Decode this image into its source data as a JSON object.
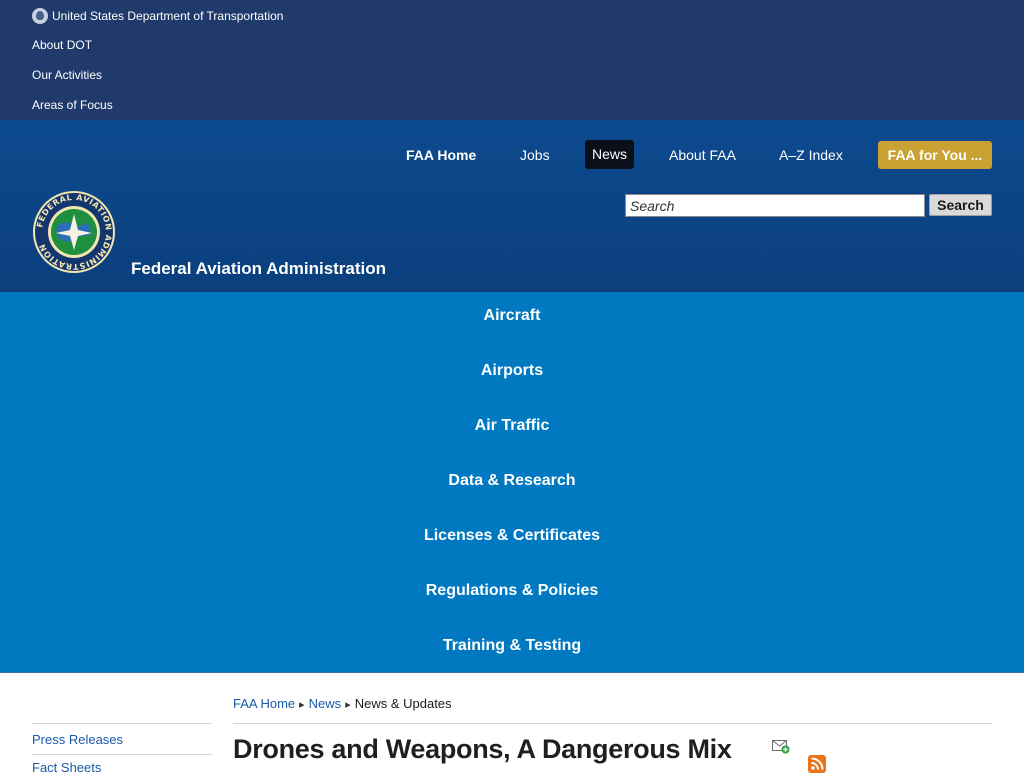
{
  "dot_bar": {
    "agency_link": "United States Department of Transportation",
    "links": [
      "About DOT",
      "Our Activities",
      "Areas of Focus"
    ]
  },
  "header": {
    "agency_name": "Federal Aviation Administration",
    "seal_text": "FEDERAL AVIATION ADMINISTRATION",
    "top_nav": {
      "home": "FAA Home",
      "jobs": "Jobs",
      "news": "News",
      "about": "About FAA",
      "az": "A–Z Index",
      "faa_for_you": "FAA for You ..."
    },
    "search": {
      "placeholder": "Search",
      "button_label": "Search"
    }
  },
  "main_nav": {
    "items": [
      "Aircraft",
      "Airports",
      "Air Traffic",
      "Data & Research",
      "Licenses & Certificates",
      "Regulations & Policies",
      "Training & Testing"
    ]
  },
  "breadcrumb": {
    "items": [
      "FAA Home",
      "News",
      "News & Updates"
    ],
    "separator": "▸"
  },
  "sidebar": {
    "links": [
      "Press Releases",
      "Fact Sheets"
    ]
  },
  "content": {
    "title": "Drones and Weapons, A Dangerous Mix"
  },
  "colors": {
    "dot_bar": "#1f3a6b",
    "faa_header": "#0d4a8e",
    "main_nav": "#0079c1",
    "faa_for_you": "#c9a233",
    "link": "#1a5aa8"
  },
  "icons": [
    "dot-seal-icon",
    "faa-seal-icon",
    "email-subscribe-icon",
    "rss-feed-icon"
  ]
}
